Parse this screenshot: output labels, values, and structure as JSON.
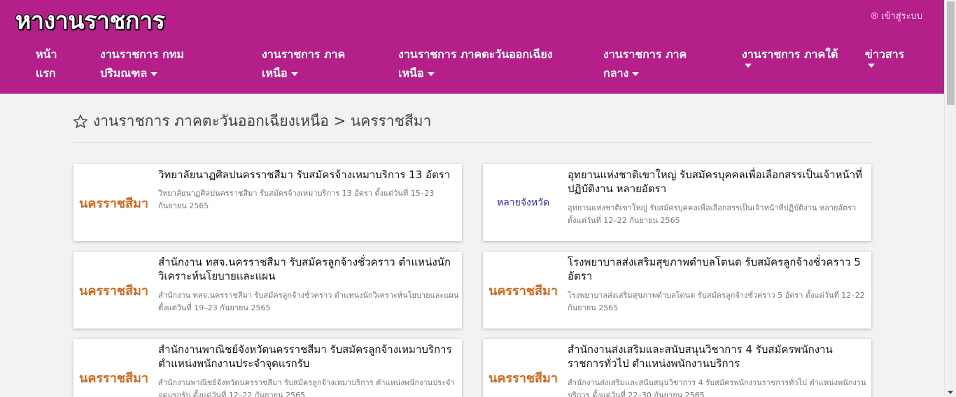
{
  "site": {
    "logo": "หางานราชการ",
    "login_icon": "®",
    "login_label": "เข้าสู่ระบบ"
  },
  "nav": [
    {
      "line1": "หน้า",
      "line2": "แรก",
      "dropdown": false
    },
    {
      "line1": "งานราชการ กทม",
      "line2": "ปริมณฑล",
      "dropdown": true
    },
    {
      "line1": "งานราชการ ภาค",
      "line2": "เหนือ",
      "dropdown": true
    },
    {
      "line1": "งานราชการ ภาคตะวันออกเฉียง",
      "line2": "เหนือ",
      "dropdown": true
    },
    {
      "line1": "งานราชการ ภาค",
      "line2": "กลาง",
      "dropdown": true
    },
    {
      "line1": "งานราชการ ภาคใต้",
      "line2": "",
      "dropdown": true
    },
    {
      "line1": "ข่าวสาร",
      "line2": "",
      "dropdown": true
    }
  ],
  "breadcrumb": "งานราชการ ภาคตะวันออกเฉียงเหนือ > นครราชสีมา",
  "jobs": [
    {
      "province": "นครราชสีมา",
      "title": "วิทยาลัยนาฏศิลปนครราชสีมา รับสมัครจ้างเหมาบริการ 13 อัตรา",
      "desc": "วิทยาลัยนาฏศิลปนครราชสีมา รับสมัครจ้างเหมาบริการ 13 อัตรา ตั้งแต่วันที่ 15–23 กันยายน 2565"
    },
    {
      "province": "หลายจังหวัด",
      "title": "อุทยานแห่งชาติเขาใหญ่ รับสมัครบุคคลเพื่อเลือกสรรเป็นเจ้าหน้าที่ปฏิบัติงาน หลายอัตรา",
      "desc": "อุทยานแห่งชาติเขาใหญ่ รับสมัครบุคคลเพื่อเลือกสรรเป็นเจ้าหน้าที่ปฏิบัติงาน หลายอัตรา ตั้งแต่วันที่ 12–22 กันยายน 2565"
    },
    {
      "province": "นครราชสีมา",
      "title": "สำนักงาน ทสจ.นครราชสีมา รับสมัครลูกจ้างชั่วคราว ตำแหน่งนักวิเคราะห์นโยบายและแผน",
      "desc": "สำนักงาน ทสจ.นครราชสีมา รับสมัครลูกจ้างชั่วคราว ตำแหน่งนักวิเคราะห์นโยบายและแผน ตั้งแต่วันที่ 19–23 กันยายน 2565"
    },
    {
      "province": "นครราชสีมา",
      "title": "โรงพยาบาลส่งเสริมสุขภาพตำบลโตนด รับสมัครลูกจ้างชั่วคราว 5 อัตรา",
      "desc": "โรงพยาบาลส่งเสริมสุขภาพตำบลโตนด รับสมัครลูกจ้างชั่วคราว 5 อัตรา ตั้งแต่วันที่ 12–22 กันยายน 2565"
    },
    {
      "province": "นครราชสีมา",
      "title": "สำนักงานพาณิชย์จังหวัดนครราชสีมา รับสมัครลูกจ้างเหมาบริการ ตำแหน่งพนักงานประจำจุดแรกรับ",
      "desc": "สำนักงานพาณิชย์จังหวัดนครราชสีมา รับสมัครลูกจ้างเหมาบริการ ตำแหน่งพนักงานประจำจุดแรกรับ ตั้งแต่วันที่ 12–22 กันยายน 2565"
    },
    {
      "province": "นครราชสีมา",
      "title": "สำนักงานส่งเสริมและสนับสนุนวิชาการ 4 รับสมัครพนักงานราชการทั่วไป ตำแหน่งพนักงานบริการ",
      "desc": "สำนักงานส่งเสริมและสนับสนุนวิชาการ 4 รับสมัครพนักงานราชการทั่วไป ตำแหน่งพนักงานบริการ ตั้งแต่วันที่ 22–30 กันยายน 2565"
    }
  ],
  "colors": {
    "header": "#b51f8a",
    "province": "#d2691e",
    "province_multi": "#2a2aa8",
    "background": "#f2f2f2"
  }
}
